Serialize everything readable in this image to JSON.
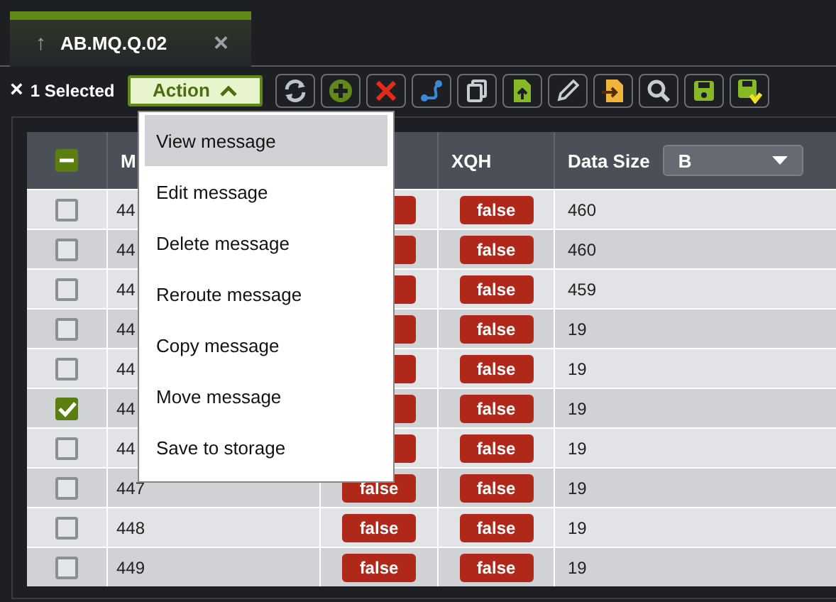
{
  "tab": {
    "icon": "↑",
    "title": "AB.MQ.Q.02",
    "close": "×"
  },
  "toolbar": {
    "clear": "×",
    "selected_count": "1 Selected",
    "action": "Action",
    "action_open": true,
    "tools": [
      {
        "kind": "refresh"
      },
      {
        "kind": "add"
      },
      {
        "kind": "delete"
      },
      {
        "kind": "route"
      },
      {
        "kind": "copy"
      },
      {
        "kind": "upload"
      },
      {
        "kind": "edit"
      },
      {
        "kind": "import"
      },
      {
        "kind": "search"
      },
      {
        "kind": "save"
      },
      {
        "kind": "save-export"
      }
    ]
  },
  "menu": [
    {
      "label": "View message",
      "selected": true
    },
    {
      "label": "Edit message",
      "selected": false
    },
    {
      "label": "Delete message",
      "selected": false
    },
    {
      "label": "Reroute message",
      "selected": false
    },
    {
      "label": "Copy message",
      "selected": false
    },
    {
      "label": "Move message",
      "selected": false
    },
    {
      "label": "Save to storage",
      "selected": false
    }
  ],
  "table": {
    "select_all_partial": true,
    "columns": [
      "M",
      "XQH",
      "Data Size"
    ],
    "unit_select": "B",
    "rows": [
      {
        "checked": false,
        "m": "44",
        "xqh": "false",
        "size": "460"
      },
      {
        "checked": false,
        "m": "44",
        "xqh": "false",
        "size": "460"
      },
      {
        "checked": false,
        "m": "44",
        "xqh": "false",
        "size": "459"
      },
      {
        "checked": false,
        "m": "44",
        "xqh": "false",
        "size": "19"
      },
      {
        "checked": false,
        "m": "44",
        "xqh": "false",
        "size": "19"
      },
      {
        "checked": true,
        "m": "44",
        "xqh": "false",
        "size": "19"
      },
      {
        "checked": false,
        "m": "44",
        "xqh": "false",
        "size": "19"
      },
      {
        "checked": false,
        "m": "447",
        "column_2": "false",
        "xqh": "false",
        "size": "19"
      },
      {
        "checked": false,
        "m": "448",
        "column_2": "false",
        "xqh": "false",
        "size": "19"
      },
      {
        "checked": false,
        "m": "449",
        "column_2": "false",
        "xqh": "false",
        "size": "19"
      }
    ]
  }
}
